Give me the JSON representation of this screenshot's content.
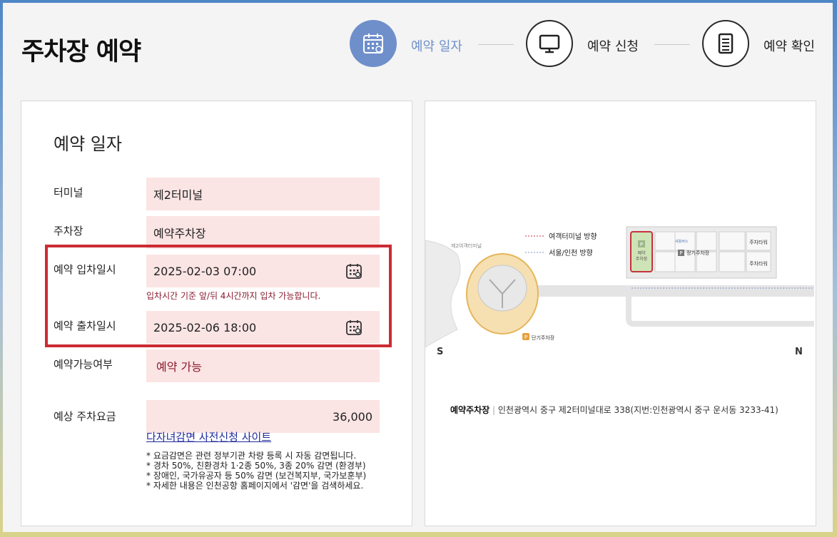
{
  "page": {
    "title": "주차장 예약"
  },
  "steps": [
    {
      "label": "예약 일자",
      "icon": "calendar-icon",
      "active": true
    },
    {
      "label": "예약 신청",
      "icon": "monitor-icon",
      "active": false
    },
    {
      "label": "예약 확인",
      "icon": "document-icon",
      "active": false
    }
  ],
  "form": {
    "section_title": "예약 일자",
    "terminal": {
      "label": "터미널",
      "value": "제2터미널"
    },
    "parking": {
      "label": "주차장",
      "value": "예약주차장"
    },
    "entry": {
      "label": "예약 입차일시",
      "value": "2025-02-03 07:00"
    },
    "entry_hint": "입차시간 기준 앞/뒤 4시간까지 입차 가능합니다.",
    "exit": {
      "label": "예약 출차일시",
      "value": "2025-02-06 18:00"
    },
    "availability": {
      "label": "예약가능여부",
      "value": "예약 가능"
    },
    "fee": {
      "label": "예상 주차요금",
      "value": "36,000"
    },
    "discount_link": "다자녀감면 사전신청 사이트",
    "notes": [
      "* 요금감면은 관련 정부기관 차량 등록 시 자동 감면됩니다.",
      "* 경차 50%, 친환경차 1·2종 50%, 3종 20% 감면 (환경부)",
      "* 장애인, 국가유공자 등 50% 감면 (보건복지부, 국가보훈부)",
      "* 자세한 내용은 인천공항 홈페이지에서 '감면'을 검색하세요."
    ]
  },
  "map": {
    "legend": {
      "passenger": "여객터미널 방향",
      "seoul": "서울/인천 방향"
    },
    "terminal_label": "제2여객터미널",
    "reserve_lot": "예약주차장",
    "reserve_lot_short": [
      "예약",
      "주차장"
    ],
    "regular_lot": "정기주차장",
    "short_lot": "단기주차장",
    "tower1": "주차타워",
    "tower2": "주차타워",
    "bus": "셔틀버스",
    "south": "S",
    "north": "N",
    "address_name": "예약주차장",
    "address_text": "인천광역시 중구 제2터미널대로 338(지번:인천광역시 중구 운서동 3233-41)"
  },
  "colors": {
    "accent": "#6f8fcb",
    "field_bg": "#fbe4e4",
    "highlight": "#cc2b34",
    "available": "#8a1b2e"
  }
}
